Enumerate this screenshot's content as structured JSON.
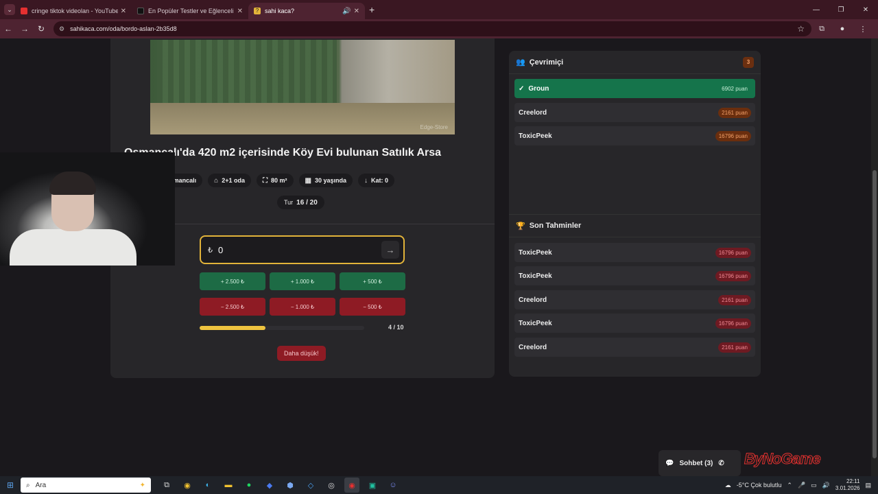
{
  "browser": {
    "tabs": [
      {
        "title": "cringe tiktok videolan - YouTube",
        "favicon_color": "#e53030"
      },
      {
        "title": "En Popüler Testler ve Eğlenceli Oyunlar",
        "favicon_color": "#111111"
      },
      {
        "title": "sahi kaca?",
        "favicon_color": "#e3b43a"
      }
    ],
    "url": "sahikaca.com/oda/bordo-aslan-2b35d8",
    "tab_icon_glyph": "?"
  },
  "listing": {
    "title": "Osmancalı'da 420 m2 içerisinde Köy Evi bulunan Satılık Arsa",
    "photo_watermark": "Edge-Store",
    "chips": [
      {
        "icon": "location-icon",
        "text": "Osmancalı"
      },
      {
        "icon": "home-icon",
        "text": "2+1 oda"
      },
      {
        "icon": "area-icon",
        "text": "80 m²"
      },
      {
        "icon": "building-icon",
        "text": "30 yaşında"
      },
      {
        "icon": "floor-icon",
        "text": "Kat: 0"
      }
    ],
    "round_label": "Tur",
    "round_value": "16 / 20"
  },
  "guess": {
    "currency": "₺",
    "value": "0",
    "plus_buttons": [
      "+ 2.500 ₺",
      "+ 1.000 ₺",
      "+ 500 ₺"
    ],
    "minus_buttons": [
      "− 2.500 ₺",
      "− 1.000 ₺",
      "− 500 ₺"
    ],
    "progress_fraction": 0.4,
    "progress_text": "4 / 10",
    "hint": "Daha düşük!"
  },
  "online": {
    "title": "Çevrimiçi",
    "count": "3",
    "players": [
      {
        "name": "Groun",
        "points": "6902 puan",
        "me": true
      },
      {
        "name": "Creelord",
        "points": "2161 puan",
        "me": false
      },
      {
        "name": "ToxicPeek",
        "points": "16796 puan",
        "me": false
      }
    ]
  },
  "recent": {
    "title": "Son Tahminler",
    "items": [
      {
        "name": "ToxicPeek",
        "points": "16796 puan"
      },
      {
        "name": "ToxicPeek",
        "points": "16796 puan"
      },
      {
        "name": "Creelord",
        "points": "2161 puan"
      },
      {
        "name": "ToxicPeek",
        "points": "16796 puan"
      },
      {
        "name": "Creelord",
        "points": "2161 puan"
      }
    ]
  },
  "chat": {
    "label": "Sohbet (3)"
  },
  "overlay": {
    "brand": "ByNoGame"
  },
  "taskbar": {
    "search_placeholder": "Ara",
    "weather": "-5°C  Çok bulutlu",
    "time": "22:11",
    "date": "3.01.2026"
  }
}
